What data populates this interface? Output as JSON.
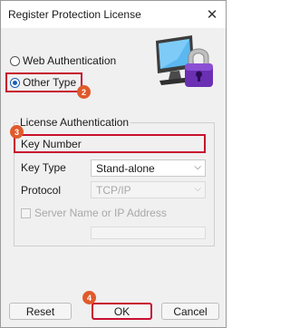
{
  "window": {
    "title": "Register Protection License",
    "close_glyph": "✕"
  },
  "auth_options": [
    {
      "label": "Web Authentication",
      "checked": false
    },
    {
      "label": "Other Type",
      "checked": true
    }
  ],
  "group": {
    "legend": "License Authentication",
    "key_number_label": "Key Number",
    "key_number_value": "",
    "key_type_label": "Key Type",
    "key_type_value": "Stand-alone",
    "protocol_label": "Protocol",
    "protocol_value": "TCP/IP",
    "server_checkbox_label": "Server Name or IP Address",
    "server_checked": false
  },
  "buttons": {
    "reset": "Reset",
    "ok": "OK",
    "cancel": "Cancel"
  },
  "badges": {
    "b2": "2",
    "b3": "3",
    "b4": "4"
  },
  "icons": {
    "license_icon": "monitor-with-padlock-icon",
    "chevron": "chevron-down-icon"
  },
  "colors": {
    "highlight": "#c8102e",
    "badge": "#e05a2b",
    "accent": "#1a5fb4"
  }
}
